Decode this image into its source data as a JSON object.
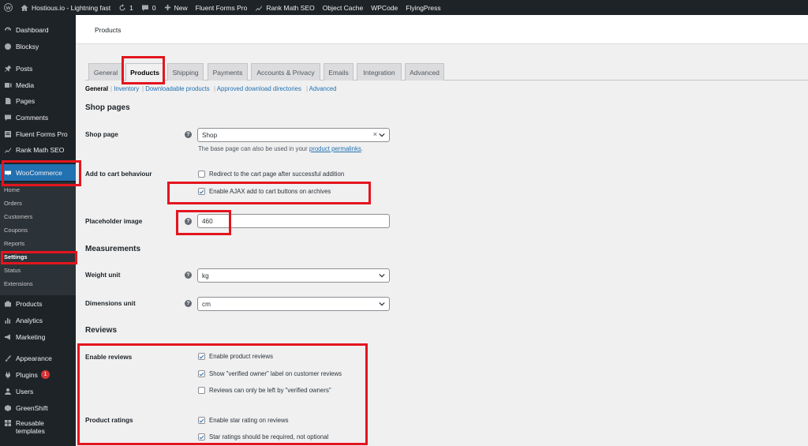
{
  "adminbar": {
    "site_name": "Hostious.io - Lightning fast",
    "updates_count": "1",
    "comments_count": "0",
    "new_label": "New",
    "items": [
      "Fluent Forms Pro",
      "Rank Math SEO",
      "Object Cache",
      "WPCode",
      "FlyingPress"
    ]
  },
  "sidebar": {
    "items": [
      {
        "label": "Dashboard",
        "icon": "dashboard-icon"
      },
      {
        "label": "Blocksy",
        "icon": "blocksy-icon"
      },
      {
        "label": "Posts",
        "icon": "pin-icon"
      },
      {
        "label": "Media",
        "icon": "media-icon"
      },
      {
        "label": "Pages",
        "icon": "pages-icon"
      },
      {
        "label": "Comments",
        "icon": "comment-icon"
      },
      {
        "label": "Fluent Forms Pro",
        "icon": "forms-icon"
      },
      {
        "label": "Rank Math SEO",
        "icon": "chart-icon"
      },
      {
        "label": "WooCommerce",
        "icon": "woo-icon"
      }
    ],
    "submenu": [
      "Home",
      "Orders",
      "Customers",
      "Coupons",
      "Reports",
      "Settings",
      "Status",
      "Extensions"
    ],
    "lower_items": [
      {
        "label": "Products",
        "icon": "products-icon"
      },
      {
        "label": "Analytics",
        "icon": "analytics-icon"
      },
      {
        "label": "Marketing",
        "icon": "megaphone-icon"
      },
      {
        "label": "Appearance",
        "icon": "brush-icon"
      },
      {
        "label": "Plugins",
        "icon": "plugin-icon",
        "badge": "1"
      },
      {
        "label": "Users",
        "icon": "users-icon"
      },
      {
        "label": "GreenShift",
        "icon": "greenshift-icon"
      },
      {
        "label": "Reusable",
        "label2": "templates",
        "icon": "grid-icon"
      }
    ]
  },
  "header": {
    "title": "Products"
  },
  "tabs": [
    "General",
    "Products",
    "Shipping",
    "Payments",
    "Accounts & Privacy",
    "Emails",
    "Integration",
    "Advanced"
  ],
  "subnav": [
    "General",
    "Inventory",
    "Downloadable products",
    "Approved download directories",
    "Advanced"
  ],
  "shop_pages": {
    "title": "Shop pages",
    "shop_page_label": "Shop page",
    "shop_page_value": "Shop",
    "shop_page_desc_prefix": "The base page can also be used in your",
    "shop_page_desc_link": "product permalinks",
    "shop_page_desc_suffix": ".",
    "cart_label": "Add to cart behaviour",
    "cart_opt1": "Redirect to the cart page after successful addition",
    "cart_opt2": "Enable AJAX add to cart buttons on archives",
    "placeholder_label": "Placeholder image",
    "placeholder_value": "460"
  },
  "measurements": {
    "title": "Measurements",
    "weight_label": "Weight unit",
    "weight_value": "kg",
    "dimensions_label": "Dimensions unit",
    "dimensions_value": "cm"
  },
  "reviews": {
    "title": "Reviews",
    "enable_label": "Enable reviews",
    "opt1": "Enable product reviews",
    "opt2": "Show \"verified owner\" label on customer reviews",
    "opt3": "Reviews can only be left by \"verified owners\"",
    "ratings_label": "Product ratings",
    "opt4": "Enable star rating on reviews",
    "opt5": "Star ratings should be required, not optional"
  },
  "checkbox_states": {
    "cart_opt1": false,
    "cart_opt2": true,
    "reviews_opt1": true,
    "reviews_opt2": true,
    "reviews_opt3": false,
    "reviews_opt4": true,
    "reviews_opt5": true
  },
  "colors": {
    "highlight": "#e3151e",
    "accent": "#2271b1",
    "sidebar_bg": "#1d2327"
  }
}
